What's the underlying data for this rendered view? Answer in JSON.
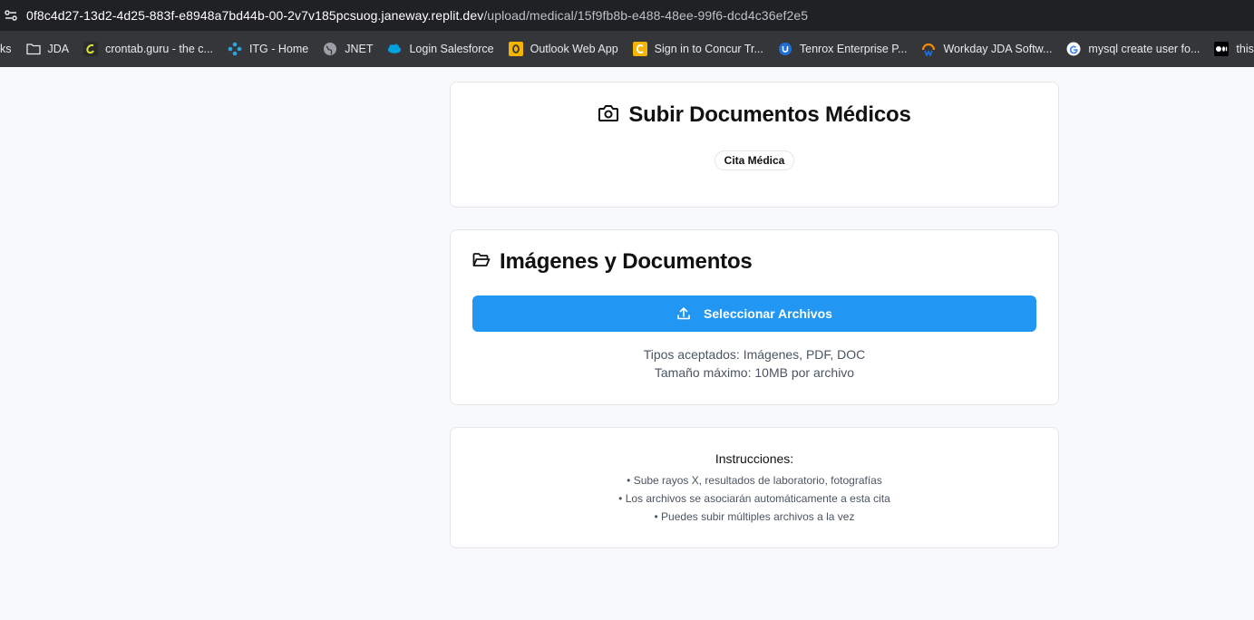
{
  "browser": {
    "url_host": "0f8c4d27-13d2-4d25-883f-e8948a7bd44b-00-2v7v185pcsuog.janeway.replit.dev",
    "url_path": "/upload/medical/15f9fb8b-e488-48ee-99f6-dcd4c36ef2e5",
    "bookmarks": [
      {
        "label": "ks",
        "icon": "none"
      },
      {
        "label": "JDA",
        "icon": "folder-icon"
      },
      {
        "label": "crontab.guru - the c...",
        "icon": "crontab-icon"
      },
      {
        "label": "ITG - Home",
        "icon": "itg-icon"
      },
      {
        "label": "JNET",
        "icon": "globe-icon"
      },
      {
        "label": "Login  Salesforce",
        "icon": "salesforce-icon"
      },
      {
        "label": "Outlook Web App",
        "icon": "outlook-icon"
      },
      {
        "label": "Sign in to Concur Tr...",
        "icon": "concur-icon"
      },
      {
        "label": "Tenrox Enterprise P...",
        "icon": "tenrox-icon"
      },
      {
        "label": "Workday JDA Softw...",
        "icon": "workday-icon"
      },
      {
        "label": "mysql create user fo...",
        "icon": "google-icon"
      },
      {
        "label": "this.redirectTo",
        "icon": "medium-icon"
      }
    ]
  },
  "header_card": {
    "title": "Subir Documentos Médicos",
    "badge": "Cita Médica"
  },
  "upload_card": {
    "title": "Imágenes y Documentos",
    "button_label": "Seleccionar Archivos",
    "accepted_types": "Tipos aceptados: Imágenes, PDF, DOC",
    "max_size": "Tamaño máximo: 10MB por archivo"
  },
  "instructions": {
    "title": "Instrucciones:",
    "items": [
      "Sube rayos X, resultados de laboratorio, fotografías",
      "Los archivos se asociarán automáticamente a esta cita",
      "Puedes subir múltiples archivos a la vez"
    ]
  },
  "colors": {
    "accent": "#2196f3",
    "background": "#f8f9fb",
    "toolbar": "#202124",
    "bookmarks_bar": "#35363a"
  }
}
